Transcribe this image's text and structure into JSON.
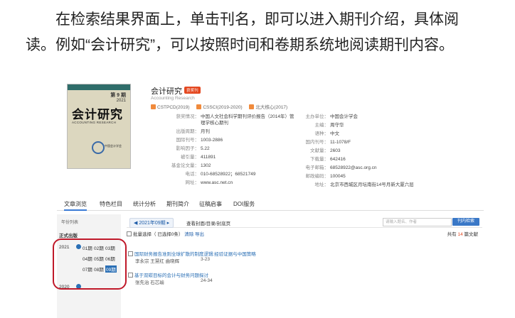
{
  "intro": {
    "line1": "在检索结果界面上，单击刊名，即可以进入期刊介绍，具体阅",
    "line2": "读。例如“会计研究”，可以按照时间和卷期系统地阅读期刊内容。"
  },
  "cover": {
    "issue": "第 9 期",
    "year": "2021",
    "title": "会计研究",
    "subtitle": "ACCOUNTING RESEARCH",
    "publisher": "中国会计学会"
  },
  "journal": {
    "title": "会计研究",
    "badge": "获奖刊",
    "subtitle": "Accounting Research  ",
    "indexes": [
      "CSTPCD(2019)",
      "CSSCI(2019-2020)",
      "北大核心(2017)"
    ]
  },
  "info_left": [
    {
      "k": "获奖情况：",
      "v": "中国人文社会科学期刊评价报告（2014年）管理学核心期刊"
    },
    {
      "k": "出版周期：",
      "v": "月刊"
    },
    {
      "k": "国际刊号：",
      "v": "1003-2886"
    },
    {
      "k": "影响因子：",
      "v": "5.22"
    },
    {
      "k": "被引量：",
      "v": "411891"
    },
    {
      "k": "基金论文量：",
      "v": "1302"
    },
    {
      "k": "电话：",
      "v": "010-68528922；68521749"
    },
    {
      "k": "网址：",
      "v": "www.asc.net.cn"
    }
  ],
  "info_right": [
    {
      "k": "主办单位：",
      "v": "中国会计学会"
    },
    {
      "k": "主编：",
      "v": "周守华"
    },
    {
      "k": "语种：",
      "v": "中文"
    },
    {
      "k": "国内刊号：",
      "v": "11-1078/F"
    },
    {
      "k": "文献量：",
      "v": "2603"
    },
    {
      "k": "下载量：",
      "v": "642416"
    },
    {
      "k": "电子邮箱：",
      "v": "68528922@asc.org.cn"
    },
    {
      "k": "邮政编码：",
      "v": "100045"
    },
    {
      "k": "地址：",
      "v": "北京市西城区月坛南街14号月新大厦六层"
    }
  ],
  "tabs": [
    "文章浏览",
    "特色栏目",
    "统计分析",
    "期刊简介",
    "征稿启事",
    "DOI服务"
  ],
  "sidebar": {
    "header": "年份列表",
    "selected_label": "正式出版",
    "year_2021": "2021",
    "issues": [
      "01期",
      "02期",
      "03期",
      "04期",
      "05期",
      "06期",
      "07期",
      "08期",
      "09期"
    ],
    "year_2020": "2020"
  },
  "main": {
    "current_issue": "◀ 2021年09期 ▸",
    "cover_link": "查看封面/目录/封底页",
    "search_placeholder": "请输入题名、作者",
    "search_button": "刊内检索",
    "batch": "批量选择（ 已选择0条）",
    "clear": "清除",
    "export": "导出",
    "count_prefix": "共有",
    "count": "14",
    "count_suffix": "篇文献",
    "articles": [
      {
        "title": "国际财务报告准则全球扩散的制度逻辑:经验证据与中国策略",
        "authors": "李永宗 王慧红 曲晓辉",
        "pages": "3-23"
      },
      {
        "title": "基于双碳目标的会计与财务问题探讨",
        "authors": "张先治 石芯瑜",
        "pages": "24-34"
      }
    ]
  }
}
